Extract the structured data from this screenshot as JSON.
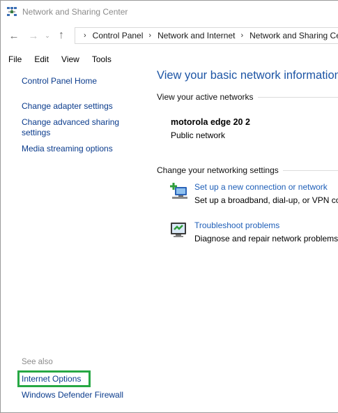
{
  "window": {
    "title": "Network and Sharing Center"
  },
  "address": {
    "crumbs": [
      "Control Panel",
      "Network and Internet",
      "Network and Sharing Center"
    ]
  },
  "menu": [
    "File",
    "Edit",
    "View",
    "Tools"
  ],
  "sidebar": {
    "links": [
      "Control Panel Home",
      "Change adapter settings",
      "Change advanced sharing settings",
      "Media streaming options"
    ],
    "see_also_label": "See also",
    "see_also": [
      "Internet Options",
      "Windows Defender Firewall"
    ]
  },
  "main": {
    "heading": "View your basic network information and set up connections",
    "active_networks_title": "View your active networks",
    "network": {
      "name": "motorola edge 20 2",
      "type": "Public network"
    },
    "change_settings_title": "Change your networking settings",
    "tasks": [
      {
        "link": "Set up a new connection or network",
        "desc": "Set up a broadband, dial-up, or VPN connection; or set up a router or access point.",
        "icon": "new-connection-icon"
      },
      {
        "link": "Troubleshoot problems",
        "desc": "Diagnose and repair network problems, or get troubleshooting information.",
        "icon": "troubleshoot-icon"
      }
    ]
  },
  "colors": {
    "link": "#0a3b8c",
    "heading": "#1d55a5",
    "highlight": "#27a844"
  }
}
